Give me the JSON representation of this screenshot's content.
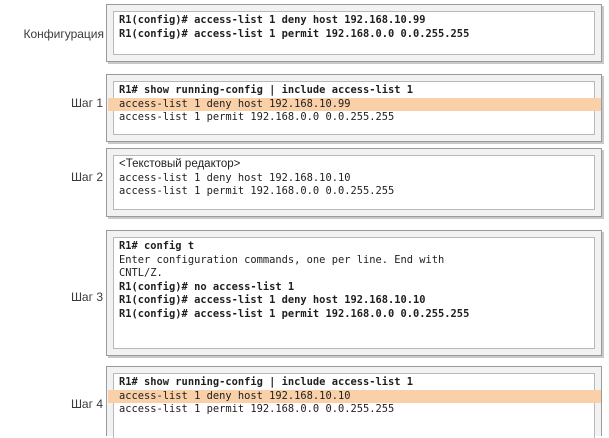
{
  "rows": [
    {
      "label": "Конфигурация",
      "lines": [
        {
          "text": "R1(config)# access-list 1 deny host 192.168.10.99",
          "style": "cmd"
        },
        {
          "text": "R1(config)# access-list 1 permit 192.168.0.0 0.0.255.255",
          "style": "cmd"
        }
      ]
    },
    {
      "label": "Шаг 1",
      "lines": [
        {
          "text": "R1# show running-config | include access-list 1",
          "style": "cmd"
        },
        {
          "text": "access-list 1 deny host 192.168.10.99",
          "style": "hl"
        },
        {
          "text": "access-list 1 permit 192.168.0.0 0.0.255.255",
          "style": "plain"
        }
      ]
    },
    {
      "label": "Шаг 2",
      "lines": [
        {
          "text": "<Текстовый редактор>",
          "style": "ed"
        },
        {
          "text": "access-list 1 deny host 192.168.10.10",
          "style": "plain"
        },
        {
          "text": "access-list 1 permit 192.168.0.0 0.0.255.255",
          "style": "plain"
        }
      ]
    },
    {
      "label": "Шаг 3",
      "lines": [
        {
          "text": "R1# config t",
          "style": "cmd"
        },
        {
          "text": "Enter configuration commands, one per line. End with",
          "style": "plain"
        },
        {
          "text": "CNTL/Z.",
          "style": "plain"
        },
        {
          "text": "R1(config)# no access-list 1",
          "style": "cmd"
        },
        {
          "text": "R1(config)# access-list 1 deny host 192.168.10.10",
          "style": "cmd"
        },
        {
          "text": "R1(config)# access-list 1 permit 192.168.0.0 0.0.255.255",
          "style": "cmd"
        }
      ]
    },
    {
      "label": "Шаг 4",
      "lines": [
        {
          "text": "R1# show running-config | include access-list 1",
          "style": "cmd"
        },
        {
          "text": "access-list 1 deny host 192.168.10.10",
          "style": "hl"
        },
        {
          "text": "access-list 1 permit 192.168.0.0 0.0.255.255",
          "style": "plain"
        }
      ]
    }
  ],
  "colors": {
    "highlight": "#fad0a8",
    "panel_bg": "#f2f2f2",
    "panel_border": "#9a9a9a"
  }
}
